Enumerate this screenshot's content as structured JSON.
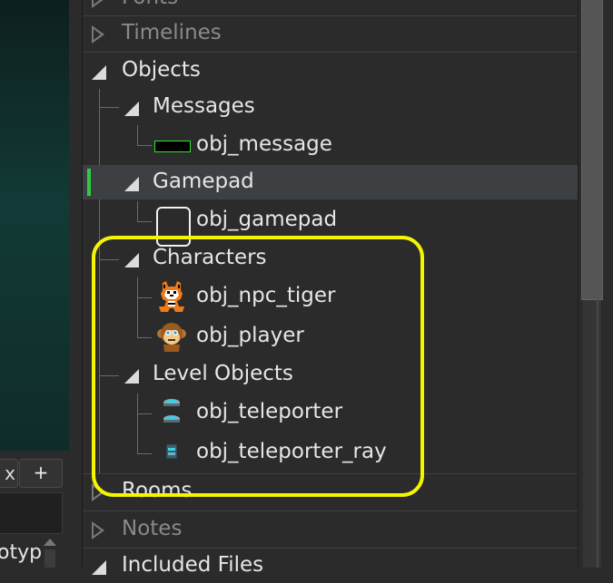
{
  "tree": {
    "items": [
      {
        "label": "Fonts"
      },
      {
        "label": "Timelines"
      },
      {
        "label": "Objects"
      },
      {
        "label": "Messages"
      },
      {
        "label": "obj_message"
      },
      {
        "label": "Gamepad"
      },
      {
        "label": "obj_gamepad"
      },
      {
        "label": "Characters"
      },
      {
        "label": "obj_npc_tiger"
      },
      {
        "label": "obj_player"
      },
      {
        "label": "Level Objects"
      },
      {
        "label": "obj_teleporter"
      },
      {
        "label": "obj_teleporter_ray"
      },
      {
        "label": "Rooms"
      },
      {
        "label": "Notes"
      },
      {
        "label": "Included Files"
      }
    ],
    "selected": "Gamepad"
  },
  "left_panel": {
    "tab_close": "x",
    "tab_add": "+",
    "partial_text": "otyp"
  },
  "colors": {
    "highlight": "#f5f500",
    "selection_marker": "#2ecc40",
    "selected_row": "#3d4043"
  },
  "icons": {
    "collapsed": "triangle-right-icon",
    "expanded": "triangle-down-icon",
    "message": "message-sprite-icon",
    "gamepad": "gamepad-sprite-icon",
    "tiger": "tiger-sprite-icon",
    "player": "monkey-sprite-icon",
    "teleporter": "teleporter-sprite-icon",
    "teleporter_ray": "teleporter-ray-sprite-icon"
  }
}
